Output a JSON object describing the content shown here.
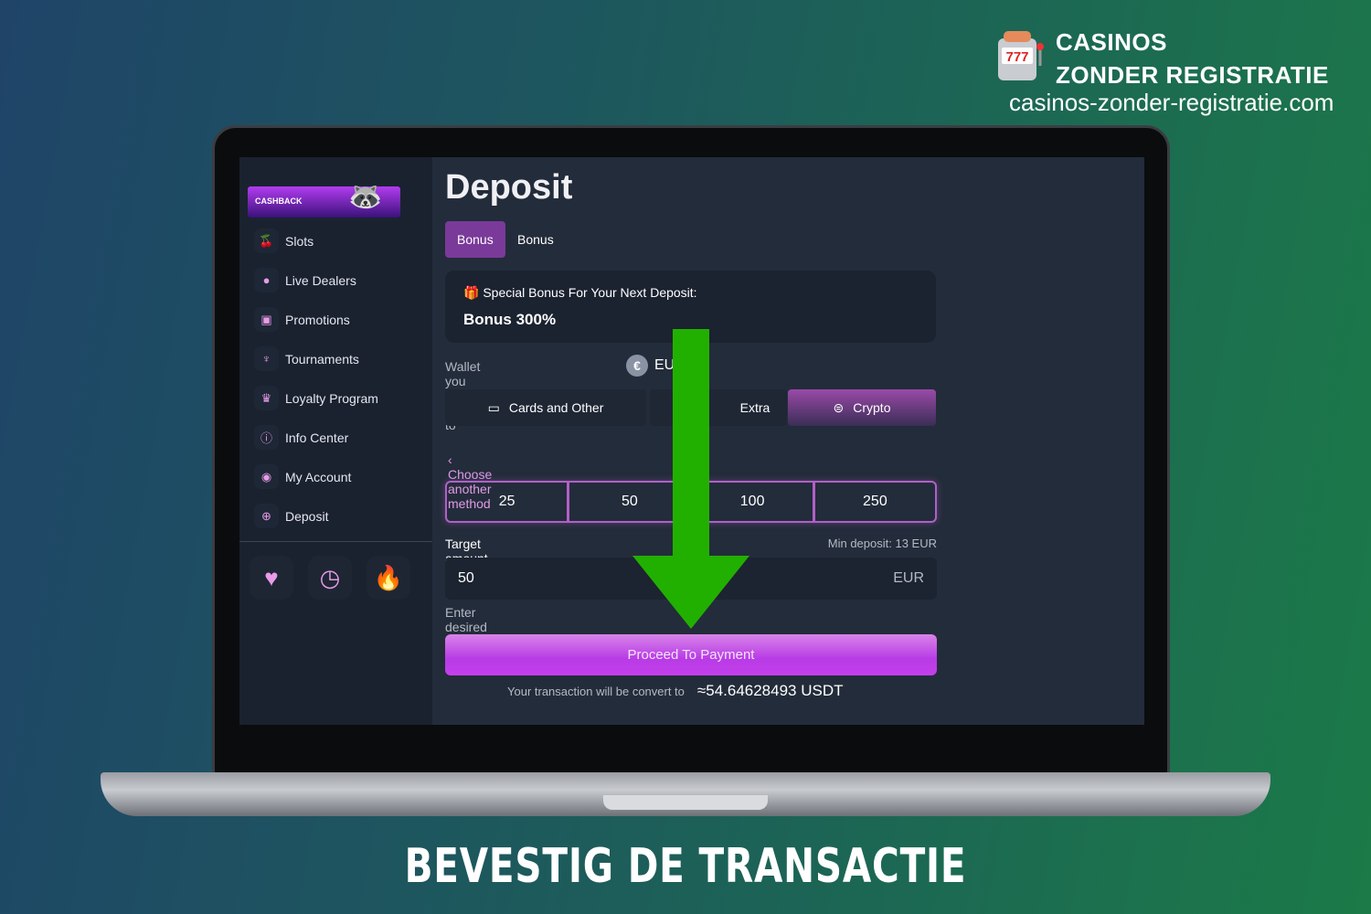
{
  "brand": {
    "line1": "CASINOS",
    "line2": "ZONDER REGISTRATIE",
    "url": "casinos-zonder-registratie.com",
    "logo_text": "777"
  },
  "caption": "BEVESTIG DE TRANSACTIE",
  "sidebar": {
    "banner": "CASHBACK",
    "items": [
      {
        "label": "Slots",
        "icon": "cherries-icon"
      },
      {
        "label": "Live Dealers",
        "icon": "person-icon"
      },
      {
        "label": "Promotions",
        "icon": "gift-icon"
      },
      {
        "label": "Tournaments",
        "icon": "trophy-icon"
      },
      {
        "label": "Loyalty Program",
        "icon": "crown-icon"
      },
      {
        "label": "Info Center",
        "icon": "info-icon"
      },
      {
        "label": "My Account",
        "icon": "account-icon"
      },
      {
        "label": "Deposit",
        "icon": "plus-circle-icon"
      }
    ],
    "footer_icons": [
      "heart-icon",
      "history-icon",
      "fire-icon"
    ]
  },
  "main": {
    "title": "Deposit",
    "tabs": [
      {
        "label": "Bonus",
        "active": true
      },
      {
        "label": "Bonus code",
        "active": false
      }
    ],
    "bonus": {
      "heading": "Special Bonus For Your Next Deposit:",
      "value": "Bonus 300%"
    },
    "wallet_label": "Wallet you want to deposit to",
    "wallet_value": "EU",
    "methods": [
      {
        "label": "Cards and Other"
      },
      {
        "label": "Extra"
      },
      {
        "label": "Crypto",
        "active": true
      }
    ],
    "choose_another": "Choose another method",
    "amounts": [
      "25",
      "50",
      "100",
      "250"
    ],
    "target_label": "Target amount",
    "min_deposit": "Min deposit: 13 EUR",
    "amount_value": "50",
    "currency": "EUR",
    "hint": "Enter desired amount",
    "proceed": "Proceed To Payment",
    "convert_label": "Your transaction will be convert to",
    "convert_value": "≈54.64628493 USDT"
  },
  "colors": {
    "accent": "#c440ec",
    "arrow": "#22b000",
    "icon_pink": "#e99be8"
  }
}
